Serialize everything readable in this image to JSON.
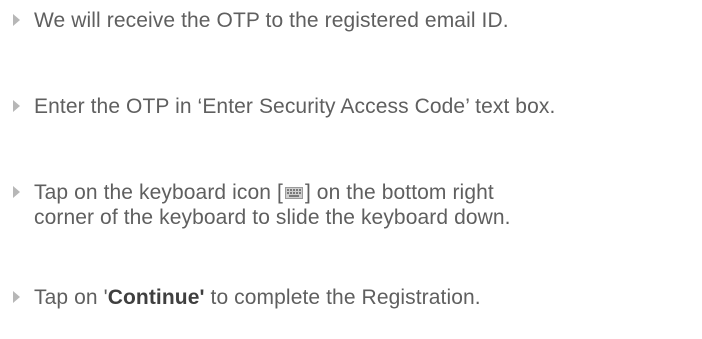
{
  "steps": [
    {
      "bullet_icon": "triangle-bullet-icon",
      "text": "We will receive the OTP to the registered email ID."
    },
    {
      "bullet_icon": "triangle-bullet-icon",
      "text": "Enter the OTP in ‘Enter Security Access Code’ text box."
    },
    {
      "bullet_icon": "triangle-bullet-icon",
      "line1_before_icon": "Tap on the keyboard icon [",
      "line1_icon": "keyboard-icon",
      "line1_after_icon": "] on the bottom right",
      "line2": "corner of the keyboard to slide the keyboard down."
    },
    {
      "bullet_icon": "triangle-bullet-icon",
      "before_strong": "Tap on '",
      "strong": "Continue'",
      "after_strong": " to complete the Registration."
    }
  ],
  "colors": {
    "text": "#5f5f5f",
    "strong_text": "#3f3f3f",
    "bullet": "#b7b7b7",
    "background": "#ffffff"
  }
}
